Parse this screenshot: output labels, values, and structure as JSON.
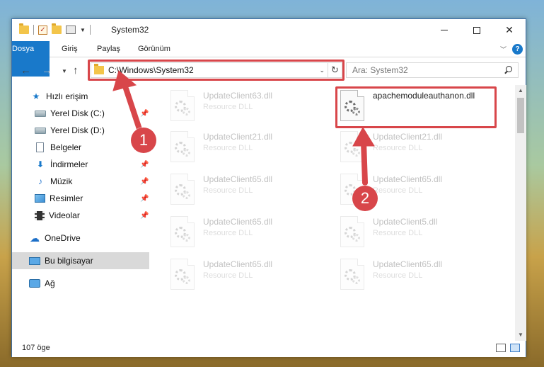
{
  "window": {
    "title": "System32",
    "title_icons": [
      "folder-icon",
      "checkmark-icon",
      "folder-icon",
      "properties-icon",
      "chevron-down-icon"
    ]
  },
  "ribbon": {
    "tabs": [
      "Dosya",
      "Giriş",
      "Paylaş",
      "Görünüm"
    ],
    "accent": "#1979ca",
    "help_label": "?"
  },
  "navigation": {
    "address_path": "C:\\Windows\\System32",
    "search_placeholder": "Ara: System32"
  },
  "sidebar": {
    "items": [
      {
        "label": "Hızlı erişim",
        "icon": "star-icon"
      },
      {
        "label": "Yerel Disk (C:)",
        "icon": "drive-icon",
        "pinned": true
      },
      {
        "label": "Yerel Disk (D:)",
        "icon": "drive-icon",
        "pinned": false
      },
      {
        "label": "Belgeler",
        "icon": "document-icon",
        "pinned": true
      },
      {
        "label": "İndirmeler",
        "icon": "download-icon",
        "pinned": true
      },
      {
        "label": "Müzik",
        "icon": "music-icon",
        "pinned": true
      },
      {
        "label": "Resimler",
        "icon": "pictures-icon",
        "pinned": true
      },
      {
        "label": "Videolar",
        "icon": "video-icon",
        "pinned": true
      },
      {
        "label": "OneDrive",
        "icon": "cloud-icon"
      },
      {
        "label": "Bu bilgisayar",
        "icon": "computer-icon",
        "selected": true
      },
      {
        "label": "Ağ",
        "icon": "network-icon"
      }
    ]
  },
  "files": [
    {
      "name": "UpdateClient63.dll",
      "type": "Resource DLL",
      "faded": true
    },
    {
      "name": "apachemoduleauthanon.dll",
      "type": "",
      "faded": false,
      "highlighted": true
    },
    {
      "name": "UpdateClient21.dll",
      "type": "Resource DLL",
      "faded": true
    },
    {
      "name": "UpdateClient21.dll",
      "type": "Resource DLL",
      "faded": true
    },
    {
      "name": "UpdateClient65.dll",
      "type": "Resource DLL",
      "faded": true
    },
    {
      "name": "UpdateClient65.dll",
      "type": "Resource DLL",
      "faded": true
    },
    {
      "name": "UpdateClient65.dll",
      "type": "Resource DLL",
      "faded": true
    },
    {
      "name": "UpdateClient5.dll",
      "type": "Resource DLL",
      "faded": true
    },
    {
      "name": "UpdateClient65.dll",
      "type": "Resource DLL",
      "faded": true
    },
    {
      "name": "UpdateClient65.dll",
      "type": "Resource DLL",
      "faded": true
    }
  ],
  "status": {
    "item_count": "107 öge"
  },
  "annotations": {
    "step1": "1",
    "step2": "2",
    "color": "#d8464a"
  }
}
